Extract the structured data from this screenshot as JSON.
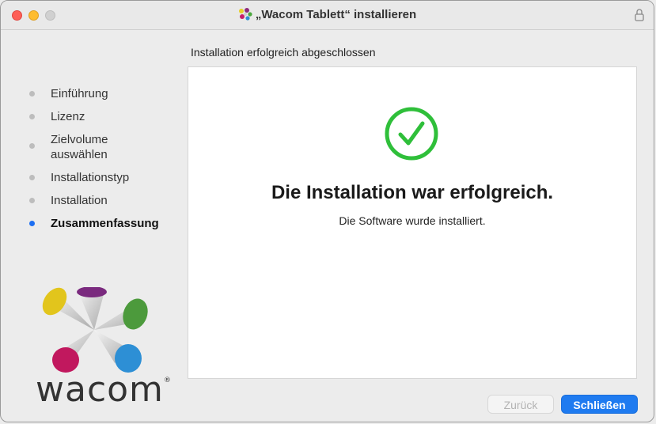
{
  "window": {
    "title": "„Wacom Tablett“ installieren"
  },
  "subheader": "Installation erfolgreich abgeschlossen",
  "steps": [
    {
      "label": "Einführung",
      "active": false
    },
    {
      "label": "Lizenz",
      "active": false
    },
    {
      "label": "Zielvolume\nauswählen",
      "active": false
    },
    {
      "label": "Installationstyp",
      "active": false
    },
    {
      "label": "Installation",
      "active": false
    },
    {
      "label": "Zusammenfassung",
      "active": true
    }
  ],
  "content": {
    "heading": "Die Installation war erfolgreich.",
    "message": "Die Software wurde installiert."
  },
  "brand": {
    "logo_text": "wacom",
    "reg_mark": "®"
  },
  "buttons": {
    "back_label": "Zurück",
    "close_label": "Schließen"
  },
  "colors": {
    "accent": "#1f7bf0",
    "success": "#2fbf3a",
    "step_inactive": "#bdbdbd",
    "step_active": "#1d6ff2"
  },
  "icons": {
    "title": "wacom-package-icon",
    "lock": "lock-icon",
    "status": "success-checkmark-icon"
  }
}
